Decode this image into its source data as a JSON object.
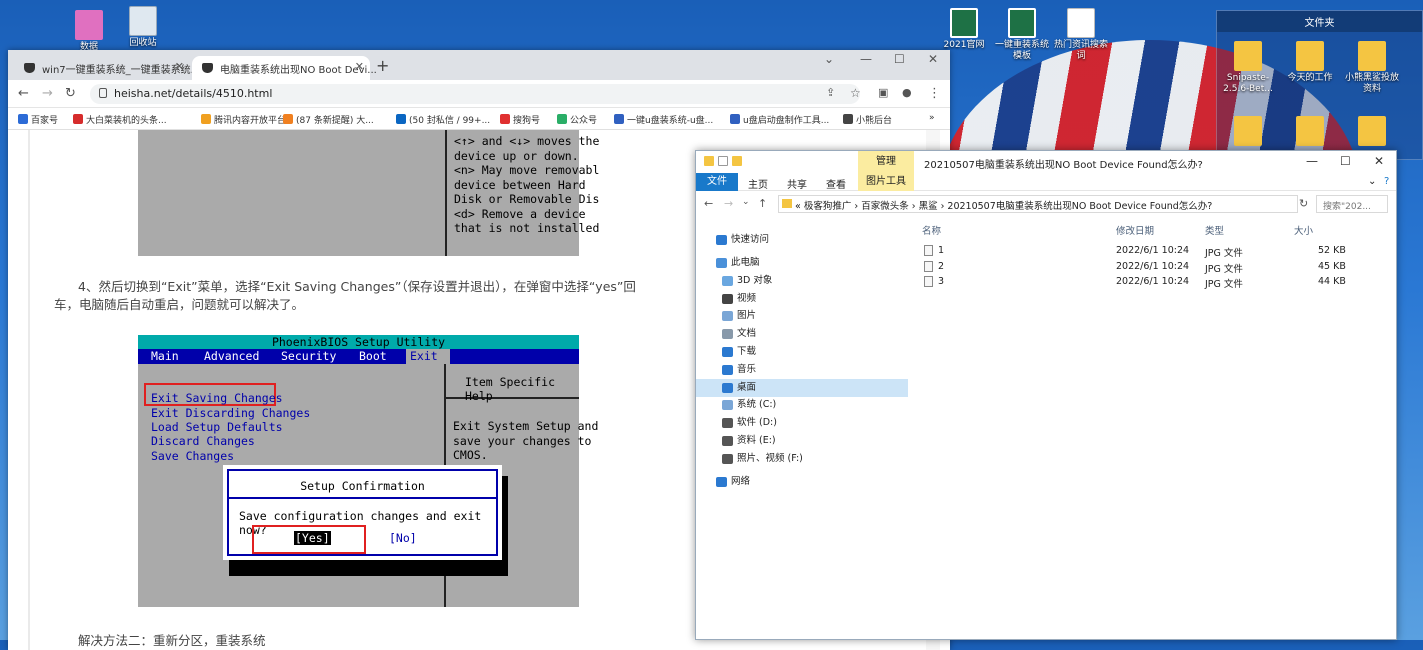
{
  "desktop": {
    "icons": [
      {
        "label": "2021官网",
        "type": "xls"
      },
      {
        "label": "一键重装系统模板",
        "type": "xls"
      },
      {
        "label": "热门资讯搜索词",
        "type": "doc"
      }
    ],
    "folder_panel": {
      "title": "文件夹",
      "folders": [
        "Snipaste-2.5.6-Bet...",
        "今天的工作",
        "小熊黑鲨投放资料"
      ]
    },
    "top_left_labels": [
      "数据",
      "回收站"
    ]
  },
  "browser": {
    "tabs": [
      {
        "label": "win7一键重装系统_一键重装系统...",
        "active": false
      },
      {
        "label": "电脑重装系统出现NO Boot Devi...",
        "active": true
      }
    ],
    "url": "heisha.net/details/4510.html",
    "bookmarks": [
      {
        "label": "百家号",
        "color": "#2c6bd6"
      },
      {
        "label": "大白菜装机的头条...",
        "color": "#d62c2c"
      },
      {
        "label": "腾讯内容开放平台",
        "color": "#f0a020"
      },
      {
        "label": "(87 条新提醒) 大...",
        "color": "#f08020"
      },
      {
        "label": "(50 封私信 / 99+...",
        "color": "#0a66c2"
      },
      {
        "label": "搜狗号",
        "color": "#e03030"
      },
      {
        "label": "公众号",
        "color": "#2aae67"
      },
      {
        "label": "一键u盘装系统-u盘...",
        "color": "#3060c0"
      },
      {
        "label": "u盘启动盘制作工具...",
        "color": "#3060c0"
      },
      {
        "label": "小熊后台",
        "color": "#444444"
      }
    ],
    "article": {
      "bios1_help": "<↑> and <↓> moves the\ndevice up or down.\n<n> May move removabl\ndevice between Hard\nDisk or Removable Dis\n<d> Remove a device\nthat is not installed",
      "paragraph": "4、然后切换到“Exit”菜单，选择“Exit Saving Changes”（保存设置并退出），在弹窗中选择“yes”回车，电脑随后自动重启，问题就可以解决了。",
      "bios2": {
        "title": "PhoenixBIOS Setup Utility",
        "menu": [
          "Main",
          "Advanced",
          "Security",
          "Boot",
          "Exit"
        ],
        "items": [
          "Exit Saving Changes",
          "Exit Discarding Changes",
          "Load Setup Defaults",
          "Discard Changes",
          "Save Changes"
        ],
        "help_title": "Item Specific Help",
        "help_text": "Exit System Setup and\nsave your changes to\nCMOS.",
        "dialog_title": "Setup Confirmation",
        "dialog_question": "Save configuration changes and exit now?",
        "yes": "[Yes]",
        "no": "[No]"
      },
      "next_heading": "解决方法二：重新分区，重装系统"
    }
  },
  "explorer": {
    "manage_tab": "管理",
    "title": "20210507电脑重装系统出现NO Boot Device Found怎么办?",
    "ribbon_tabs": [
      "文件",
      "主页",
      "共享",
      "查看",
      "图片工具"
    ],
    "address": [
      "极客狗推广",
      "百家微头条",
      "黑鲨",
      "20210507电脑重装系统出现NO Boot Device Found怎么办?"
    ],
    "search_placeholder": "搜索\"202...",
    "sidebar": [
      {
        "label": "快速访问",
        "color": "#2b79d0",
        "level": 0
      },
      {
        "label": "此电脑",
        "color": "#4a90d9",
        "level": 0
      },
      {
        "label": "3D 对象",
        "color": "#6aa7e0",
        "level": 1
      },
      {
        "label": "视频",
        "color": "#444444",
        "level": 1
      },
      {
        "label": "图片",
        "color": "#7aa6d6",
        "level": 1
      },
      {
        "label": "文档",
        "color": "#8899aa",
        "level": 1
      },
      {
        "label": "下载",
        "color": "#2b79d0",
        "level": 1
      },
      {
        "label": "音乐",
        "color": "#2b79d0",
        "level": 1
      },
      {
        "label": "桌面",
        "color": "#2b79d0",
        "level": 1,
        "selected": true
      },
      {
        "label": "系统 (C:)",
        "color": "#7aa6d6",
        "level": 1
      },
      {
        "label": "软件 (D:)",
        "color": "#555555",
        "level": 1
      },
      {
        "label": "资料 (E:)",
        "color": "#555555",
        "level": 1
      },
      {
        "label": "照片、视频 (F:)",
        "color": "#555555",
        "level": 1
      },
      {
        "label": "网络",
        "color": "#2b79d0",
        "level": 0
      }
    ],
    "columns": [
      "名称",
      "修改日期",
      "类型",
      "大小"
    ],
    "files": [
      {
        "name": "1",
        "date": "2022/6/1 10:24",
        "type": "JPG 文件",
        "size": "52 KB"
      },
      {
        "name": "2",
        "date": "2022/6/1 10:24",
        "type": "JPG 文件",
        "size": "45 KB"
      },
      {
        "name": "3",
        "date": "2022/6/1 10:24",
        "type": "JPG 文件",
        "size": "44 KB"
      }
    ]
  }
}
